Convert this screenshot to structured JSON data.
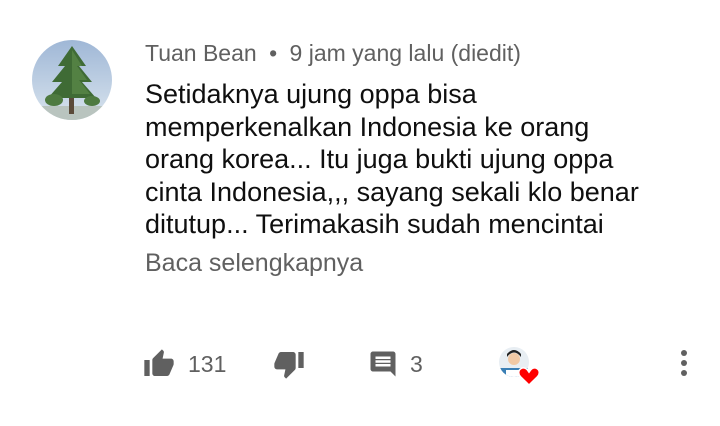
{
  "comment": {
    "author": "Tuan Bean",
    "separator": "•",
    "time": "9 jam yang lalu (diedit)",
    "text_lines": [
      "Setidaknya ujung oppa bisa",
      "memperkenalkan Indonesia ke orang",
      "orang korea... Itu juga bukti ujung oppa",
      "cinta Indonesia,,, sayang sekali klo benar",
      "ditutup... Terimakasih sudah mencintai"
    ],
    "read_more": "Baca selengkapnya",
    "likes": "131",
    "replies": "3"
  },
  "icons": {
    "avatar": "tree-avatar",
    "like": "thumbs-up-icon",
    "dislike": "thumbs-down-icon",
    "reply": "comment-icon",
    "creator_heart": "creator-heart-icon",
    "more": "more-vert-icon"
  },
  "colors": {
    "text_primary": "#0f0f0f",
    "text_secondary": "#606060",
    "icon": "#606060",
    "heart": "#ff0000"
  }
}
